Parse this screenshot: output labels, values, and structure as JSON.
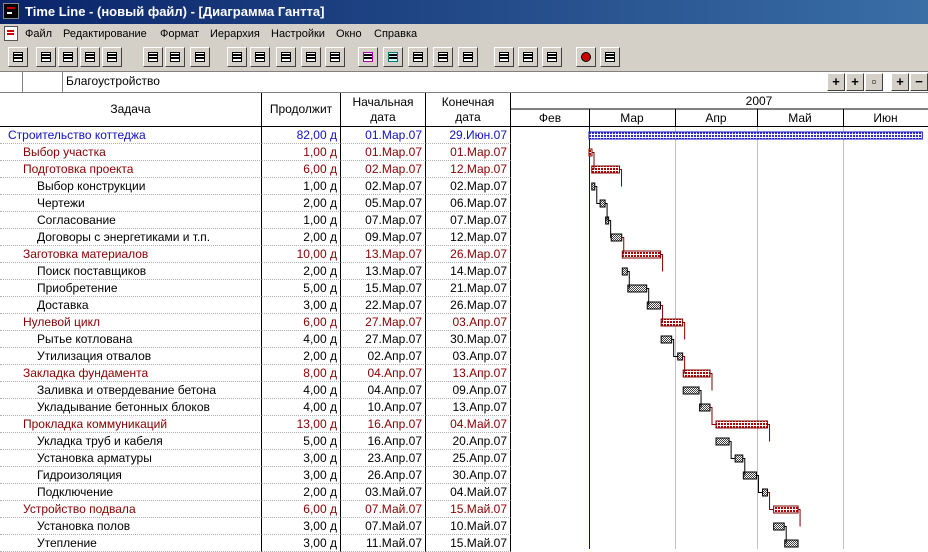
{
  "window": {
    "title": "Time Line - (новый файл) - [Диаграмма Гантта]"
  },
  "menu": [
    "Файл",
    "Редактирование",
    "Формат",
    "Иерархия",
    "Настройки",
    "Окно",
    "Справка"
  ],
  "toolbar_icons": [
    "project-icon",
    "new-doc-icon",
    "print-icon",
    "copy-icon",
    "calendar-icon",
    "resource-icon",
    "paste-icon",
    "clipboard-icon",
    "outline-icon",
    "list-icon",
    "indent-icon",
    "outdent-icon",
    "move-up-icon",
    "font-icon",
    "highlight-icon",
    "link-icon",
    "edit-icon",
    "bar-style-icon",
    "chart-icon",
    "window-icon",
    "zoom-100-icon",
    "view-icon",
    "help-pointer-icon"
  ],
  "address": {
    "value": "Благоустройство"
  },
  "columns": {
    "task": "Задача",
    "duration": "Продолжит",
    "start": "Начальная дата",
    "start_line1": "Начальная",
    "start_line2": "дата",
    "end_line1": "Конечная",
    "end_line2": "дата"
  },
  "timeline": {
    "year": "2007",
    "months": [
      "Фев",
      "Мар",
      "Апр",
      "Май",
      "Июн"
    ]
  },
  "tasks": [
    {
      "name": "Строительство коттеджа",
      "duration": "82,00 д",
      "start": "01.Мар.07",
      "end": "29.Июн.07",
      "level": 0,
      "summary": true,
      "s": 1,
      "e": 121
    },
    {
      "name": "Выбор участка",
      "duration": "1,00 д",
      "start": "01.Мар.07",
      "end": "01.Мар.07",
      "level": 1,
      "summary": true,
      "s": 1,
      "e": 1.8
    },
    {
      "name": "Подготовка проекта",
      "duration": "6,00 д",
      "start": "02.Мар.07",
      "end": "12.Мар.07",
      "level": 1,
      "summary": true,
      "s": 2,
      "e": 12
    },
    {
      "name": "Выбор конструкции",
      "duration": "1,00 д",
      "start": "02.Мар.07",
      "end": "02.Мар.07",
      "level": 2,
      "summary": false,
      "s": 2,
      "e": 2.8
    },
    {
      "name": "Чертежи",
      "duration": "2,00 д",
      "start": "05.Мар.07",
      "end": "06.Мар.07",
      "level": 2,
      "summary": false,
      "s": 5,
      "e": 6.8
    },
    {
      "name": "Согласование",
      "duration": "1,00 д",
      "start": "07.Мар.07",
      "end": "07.Мар.07",
      "level": 2,
      "summary": false,
      "s": 7,
      "e": 7.8
    },
    {
      "name": "Договоры с энергетиками и т.п.",
      "duration": "2,00 д",
      "start": "09.Мар.07",
      "end": "12.Мар.07",
      "level": 2,
      "summary": false,
      "s": 9,
      "e": 12.8
    },
    {
      "name": "Заготовка материалов",
      "duration": "10,00 д",
      "start": "13.Мар.07",
      "end": "26.Мар.07",
      "level": 1,
      "summary": true,
      "s": 13,
      "e": 26.8
    },
    {
      "name": "Поиск поставщиков",
      "duration": "2,00 д",
      "start": "13.Мар.07",
      "end": "14.Мар.07",
      "level": 2,
      "summary": false,
      "s": 13,
      "e": 14.8
    },
    {
      "name": "Приобретение",
      "duration": "5,00 д",
      "start": "15.Мар.07",
      "end": "21.Мар.07",
      "level": 2,
      "summary": false,
      "s": 15,
      "e": 21.8
    },
    {
      "name": "Доставка",
      "duration": "3,00 д",
      "start": "22.Мар.07",
      "end": "26.Мар.07",
      "level": 2,
      "summary": false,
      "s": 22,
      "e": 26.8
    },
    {
      "name": "Нулевой цикл",
      "duration": "6,00 д",
      "start": "27.Мар.07",
      "end": "03.Апр.07",
      "level": 1,
      "summary": true,
      "s": 27,
      "e": 34.8
    },
    {
      "name": "Рытье котлована",
      "duration": "4,00 д",
      "start": "27.Мар.07",
      "end": "30.Мар.07",
      "level": 2,
      "summary": false,
      "s": 27,
      "e": 30.8
    },
    {
      "name": "Утилизация отвалов",
      "duration": "2,00 д",
      "start": "02.Апр.07",
      "end": "03.Апр.07",
      "level": 2,
      "summary": false,
      "s": 33,
      "e": 34.8
    },
    {
      "name": "Закладка фундамента",
      "duration": "8,00 д",
      "start": "04.Апр.07",
      "end": "13.Апр.07",
      "level": 1,
      "summary": true,
      "s": 35,
      "e": 44.8
    },
    {
      "name": "Заливка и отвердевание бетона",
      "duration": "4,00 д",
      "start": "04.Апр.07",
      "end": "09.Апр.07",
      "level": 2,
      "summary": false,
      "s": 35,
      "e": 40.8
    },
    {
      "name": "Укладывание бетонных блоков",
      "duration": "4,00 д",
      "start": "10.Апр.07",
      "end": "13.Апр.07",
      "level": 2,
      "summary": false,
      "s": 41,
      "e": 44.8
    },
    {
      "name": "Прокладка коммуникаций",
      "duration": "13,00 д",
      "start": "16.Апр.07",
      "end": "04.Май.07",
      "level": 1,
      "summary": true,
      "s": 47,
      "e": 65.8
    },
    {
      "name": "Укладка труб и кабеля",
      "duration": "5,00 д",
      "start": "16.Апр.07",
      "end": "20.Апр.07",
      "level": 2,
      "summary": false,
      "s": 47,
      "e": 51.8
    },
    {
      "name": "Установка арматуры",
      "duration": "3,00 д",
      "start": "23.Апр.07",
      "end": "25.Апр.07",
      "level": 2,
      "summary": false,
      "s": 54,
      "e": 56.8
    },
    {
      "name": "Гидроизоляция",
      "duration": "3,00 д",
      "start": "26.Апр.07",
      "end": "30.Апр.07",
      "level": 2,
      "summary": false,
      "s": 57,
      "e": 61.8
    },
    {
      "name": "Подключение",
      "duration": "2,00 д",
      "start": "03.Май.07",
      "end": "04.Май.07",
      "level": 2,
      "summary": false,
      "s": 64,
      "e": 65.8
    },
    {
      "name": "Устройство подвала",
      "duration": "6,00 д",
      "start": "07.Май.07",
      "end": "15.Май.07",
      "level": 1,
      "summary": true,
      "s": 68,
      "e": 76.8
    },
    {
      "name": "Установка полов",
      "duration": "3,00 д",
      "start": "07.Май.07",
      "end": "10.Май.07",
      "level": 2,
      "summary": false,
      "s": 68,
      "e": 71.8
    },
    {
      "name": "Утепление",
      "duration": "3,00 д",
      "start": "11.Май.07",
      "end": "15.Май.07",
      "level": 2,
      "summary": false,
      "s": 72,
      "e": 76.8
    }
  ],
  "colors": {
    "summary_root": "#1010c0",
    "summary": "#880000",
    "task": "#000000",
    "today_line": "#0000c0"
  }
}
